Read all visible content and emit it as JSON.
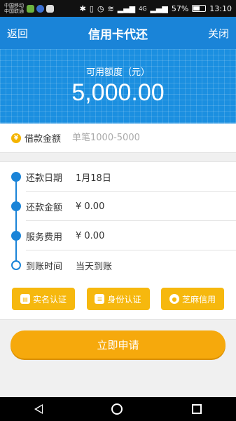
{
  "status_bar": {
    "carrier_lines": [
      "中国移动",
      "中国联通"
    ],
    "network": "4G",
    "battery": "57%",
    "battery_level": 0.57,
    "time": "13:10"
  },
  "nav": {
    "back_label": "返回",
    "title": "信用卡代还",
    "close_label": "关闭"
  },
  "limit": {
    "label": "可用额度（元）",
    "amount": "5,000.00"
  },
  "loan": {
    "icon": "¥",
    "label": "借款金额",
    "placeholder": "单笔1000-5000",
    "value": ""
  },
  "details": [
    {
      "label": "还款日期",
      "value": "1月18日"
    },
    {
      "label": "还款金额",
      "value": "¥ 0.00"
    },
    {
      "label": "服务费用",
      "value": "¥ 0.00"
    },
    {
      "label": "到账时间",
      "value": "当天到账"
    }
  ],
  "auth_buttons": [
    {
      "label": "实名认证",
      "icon": "id-card-icon"
    },
    {
      "label": "身份认证",
      "icon": "identity-icon"
    },
    {
      "label": "芝麻信用",
      "icon": "sesame-credit-icon"
    }
  ],
  "apply_label": "立即申请",
  "colors": {
    "primary_blue": "#1a84d8",
    "accent_orange": "#f6a90c",
    "auth_yellow": "#f6b80e"
  }
}
